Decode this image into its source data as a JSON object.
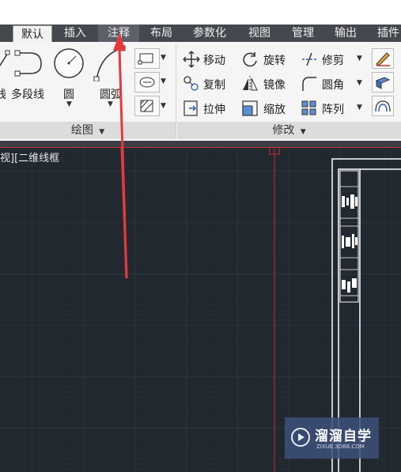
{
  "tabs": [
    {
      "label": "默认"
    },
    {
      "label": "插入"
    },
    {
      "label": "注释"
    },
    {
      "label": "布局"
    },
    {
      "label": "参数化"
    },
    {
      "label": "视图"
    },
    {
      "label": "管理"
    },
    {
      "label": "输出"
    },
    {
      "label": "插件"
    }
  ],
  "draw_panel": {
    "title": "绘图",
    "partial_label": "线",
    "polyline_label": "多段线",
    "circle_label": "圆",
    "arc_label": "圆弧"
  },
  "modify_panel": {
    "title": "修改",
    "tools": {
      "move": "移动",
      "rotate": "旋转",
      "trim": "修剪",
      "copy": "复制",
      "mirror": "镜像",
      "fillet": "圆角",
      "stretch": "拉伸",
      "scale": "缩放",
      "array": "阵列"
    }
  },
  "viewport": {
    "label": "视][二维线框"
  },
  "watermark": {
    "brand": "溜溜自学",
    "url": "ZIXUE.3D66.COM"
  },
  "colors": {
    "tab_bar": "#44484f",
    "ribbon": "#f5f5f5",
    "canvas": "#212830",
    "arrow": "#e8383b",
    "crosshair": "#d03030"
  }
}
